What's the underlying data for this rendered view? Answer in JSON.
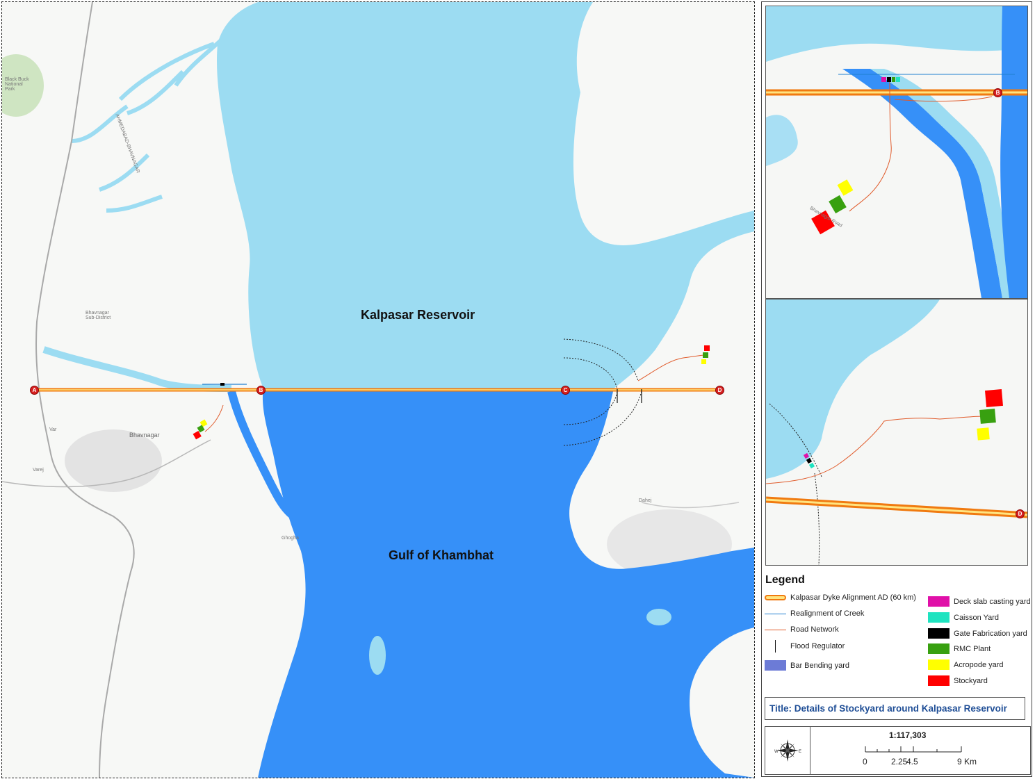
{
  "map": {
    "reservoir_label": "Kalpasar Reservoir",
    "gulf_label": "Gulf of Khambhat",
    "markers": [
      "A",
      "B",
      "C",
      "D"
    ],
    "place_labels": {
      "bhavnagar": "Bhavnagar",
      "bhavnagar_subdistrict": "Bhavnagar Sub-District",
      "blackbuck": "Black Buck National Park",
      "dahej": "Dahej",
      "ghogha": "Ghogha",
      "var": "Var",
      "varej": "Varej",
      "ahmedabad_bhavnagar": "AHMEDABAD-BHAVNAGAR"
    }
  },
  "inset_top": {
    "marker": "B",
    "place": "Bhavnagar Road"
  },
  "inset_bottom": {
    "marker": "D"
  },
  "legend": {
    "title": "Legend",
    "left_items": [
      {
        "name": "dyke-alignment",
        "label": "Kalpasar Dyke Alignment AD (60 km)"
      },
      {
        "name": "realignment-creek",
        "label": "Realignment of Creek"
      },
      {
        "name": "road-network",
        "label": "Road Network"
      },
      {
        "name": "flood-regulator",
        "label": "Flood Regulator"
      },
      {
        "name": "bar-bending",
        "label": "Bar Bending yard"
      }
    ],
    "right_items": [
      {
        "name": "deck-slab",
        "label": "Deck slab casting yard",
        "color": "#e010a8"
      },
      {
        "name": "caisson",
        "label": "Caisson Yard",
        "color": "#1ee3c0"
      },
      {
        "name": "gate-fabrication",
        "label": "Gate Fabrication yard",
        "color": "#000000"
      },
      {
        "name": "rmc-plant",
        "label": "RMC Plant",
        "color": "#38a010"
      },
      {
        "name": "acropode",
        "label": "Acropode yard",
        "color": "#ffff00"
      },
      {
        "name": "stockyard",
        "label": "Stockyard",
        "color": "#ff0000"
      }
    ],
    "colors": {
      "dyke_outer": "#f07a10",
      "dyke_inner": "#ffe480",
      "creek": "#1f7fd0",
      "road": "#e05a2a",
      "bar_bending": "#6c7bd6"
    }
  },
  "title": "Title: Details of Stockyard around Kalpasar Reservoir",
  "scale": {
    "ratio": "1:117,303",
    "ticks": [
      "0",
      "2.25",
      "4.5",
      "9 Km"
    ]
  },
  "colors": {
    "reservoir": "#9cdcf2",
    "gulf": "#3690f8",
    "land": "#f7f8f6"
  }
}
